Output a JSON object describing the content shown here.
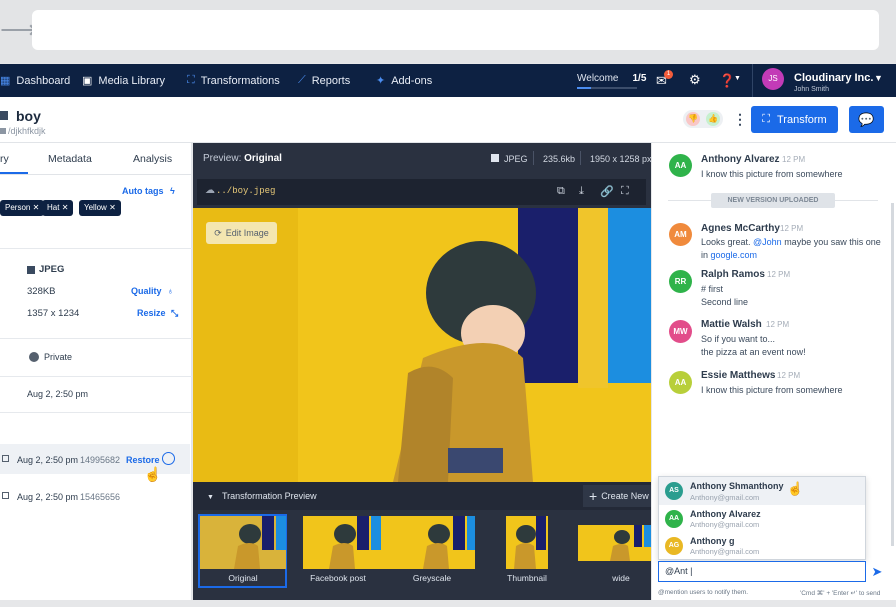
{
  "nav": {
    "items": [
      {
        "label": "Dashboard",
        "icon": "dashboard-icon"
      },
      {
        "label": "Media Library",
        "icon": "media-library-icon"
      },
      {
        "label": "Transformations",
        "icon": "transformations-icon"
      },
      {
        "label": "Reports",
        "icon": "reports-icon"
      },
      {
        "label": "Add-ons",
        "icon": "addons-icon"
      }
    ],
    "welcome_label": "Welcome",
    "welcome_progress": "1/5",
    "badge_count": "1",
    "avatar_initials": "JS",
    "account_name": "Cloudinary Inc.",
    "user_name": "John Smith"
  },
  "asset": {
    "name": "boy",
    "path": "/djkhfkdjk"
  },
  "header": {
    "transform_label": "Transform"
  },
  "left_panel": {
    "tabs": [
      "ry",
      "Metadata",
      "Analysis"
    ],
    "auto_tags_label": "Auto tags",
    "tags": [
      "Person",
      "Hat",
      "Yellow"
    ],
    "format": "JPEG",
    "size": "328KB",
    "dimensions": "1357 x 1234",
    "quality_label": "Quality",
    "resize_label": "Resize",
    "access": "Private",
    "created": "Aug 2, 2:50 pm",
    "versions": [
      {
        "date": "Aug 2, 2:50 pm",
        "id": "14995682",
        "action": "Restore"
      },
      {
        "date": "Aug 2, 2:50 pm",
        "id": "15465656"
      }
    ]
  },
  "preview": {
    "label_prefix": "Preview:",
    "label_value": "Original",
    "format": "JPEG",
    "filesize": "235.6kb",
    "dimensions": "1950 x 1258 px",
    "url": "../boy.jpeg",
    "edit_image_label": "Edit Image",
    "transformation_preview_label": "Transformation Preview",
    "create_new_label": "Create New",
    "thumbnails": [
      "Original",
      "Facebook post",
      "Greyscale",
      "Thumbnail",
      "wide"
    ]
  },
  "comments": {
    "items": [
      {
        "initials": "AA",
        "name": "Anthony Alvarez",
        "time": "12 PM",
        "lines": [
          "I know this picture from somewhere"
        ],
        "color": "#2fb34a"
      },
      {
        "initials": "AM",
        "name": "Agnes McCarthy",
        "time": "12 PM",
        "lines": [
          "Looks great. ",
          "@John",
          " maybe you saw this one",
          "in ",
          "google.com"
        ],
        "color": "#f08a3c"
      },
      {
        "initials": "RR",
        "name": "Ralph Ramos",
        "time": "12 PM",
        "lines": [
          "# first",
          "Second line"
        ],
        "color": "#2fb34a"
      },
      {
        "initials": "MW",
        "name": "Mattie Walsh",
        "time": "12 PM",
        "lines": [
          "So if you want to...",
          "the pizza at an event now!"
        ],
        "color": "#e24d8a"
      },
      {
        "initials": "AA",
        "name": "Essie Matthews",
        "time": "12 PM",
        "lines": [
          "I know this picture from somewhere"
        ],
        "color": "#b8cf3a"
      }
    ],
    "new_version_label": "NEW VERSION UPLOADED",
    "mentions": [
      {
        "initials": "AS",
        "name": "Anthony Shmanthony",
        "email": "Anthony@gmail.com",
        "color": "#2a9d8f"
      },
      {
        "initials": "AA",
        "name": "Anthony Alvarez",
        "email": "Anthony@gmail.com",
        "color": "#2fb34a"
      },
      {
        "initials": "AG",
        "name": "Anthony g",
        "email": "Anthony@gmail.com",
        "color": "#e9b824"
      }
    ],
    "input_value": "@Ant |",
    "mention_hint": "@mention users to notify them.",
    "send_hint": "'Cmd ⌘' + 'Enter ↵' to send"
  }
}
